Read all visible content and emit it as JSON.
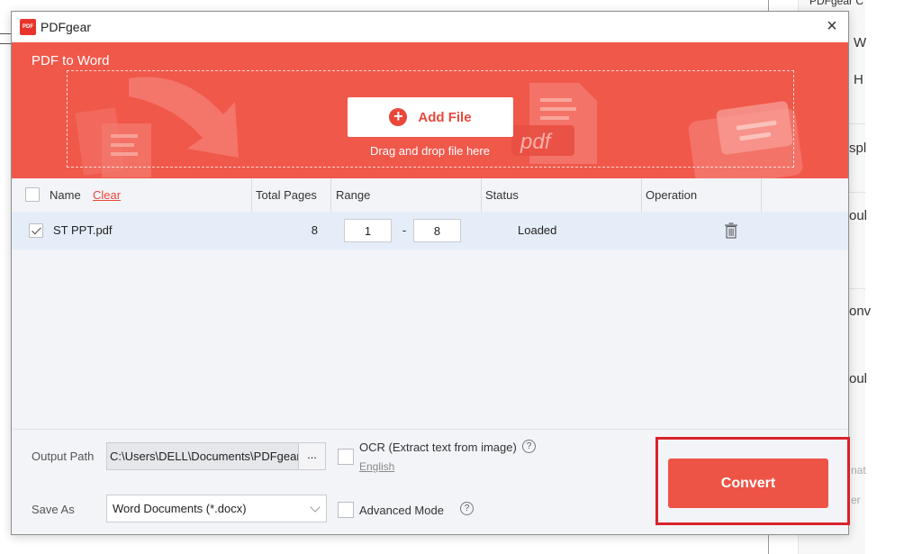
{
  "background": {
    "fragments": [
      "PDFgear C",
      "W",
      "H",
      "spl",
      "oul",
      "onv",
      "oul",
      "nat",
      "er"
    ]
  },
  "dialog": {
    "app_name": "PDFgear",
    "logo_text": "PDF",
    "close_label": "×",
    "banner": {
      "title": "PDF to Word",
      "add_file_label": "Add File",
      "drag_hint": "Drag and drop file here",
      "decor_text": "pdf"
    },
    "table": {
      "columns": {
        "name": "Name",
        "clear": "Clear",
        "total_pages": "Total Pages",
        "range": "Range",
        "status": "Status",
        "operation": "Operation"
      },
      "rows": [
        {
          "checked": true,
          "name": "ST PPT.pdf",
          "total_pages": "8",
          "range_from": "1",
          "range_separator": "-",
          "range_to": "8",
          "status": "Loaded"
        }
      ]
    },
    "footer": {
      "output_path_label": "Output Path",
      "output_path_value": "C:\\Users\\DELL\\Documents\\PDFgear",
      "browse_label": "...",
      "save_as_label": "Save As",
      "save_as_value": "Word Documents (*.docx)",
      "ocr_label": "OCR (Extract text from image)",
      "ocr_language": "English",
      "advanced_mode_label": "Advanced Mode",
      "help_glyph": "?",
      "convert_label": "Convert"
    }
  },
  "colors": {
    "accent": "#f0584a",
    "highlight": "#d8232a",
    "row_selected": "#e5eef8"
  }
}
